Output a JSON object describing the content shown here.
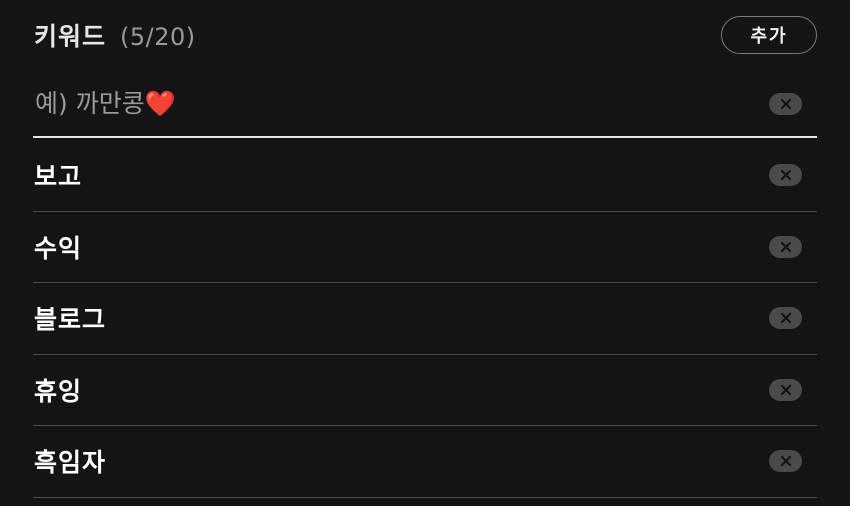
{
  "header": {
    "title": "키워드",
    "count": "(5/20)",
    "add_label": "추가"
  },
  "input": {
    "placeholder": "예) 까만콩❤️",
    "value": ""
  },
  "keywords": [
    {
      "label": "보고"
    },
    {
      "label": "수익"
    },
    {
      "label": "블로그"
    },
    {
      "label": "휴잉"
    },
    {
      "label": "흑임자"
    }
  ],
  "icons": {
    "clear": "close-icon"
  },
  "colors": {
    "background": "#141414",
    "text": "#ffffff",
    "muted": "#9a9a9a",
    "clear_bg": "#4a4a4a",
    "divider": "#4a4a4a"
  }
}
